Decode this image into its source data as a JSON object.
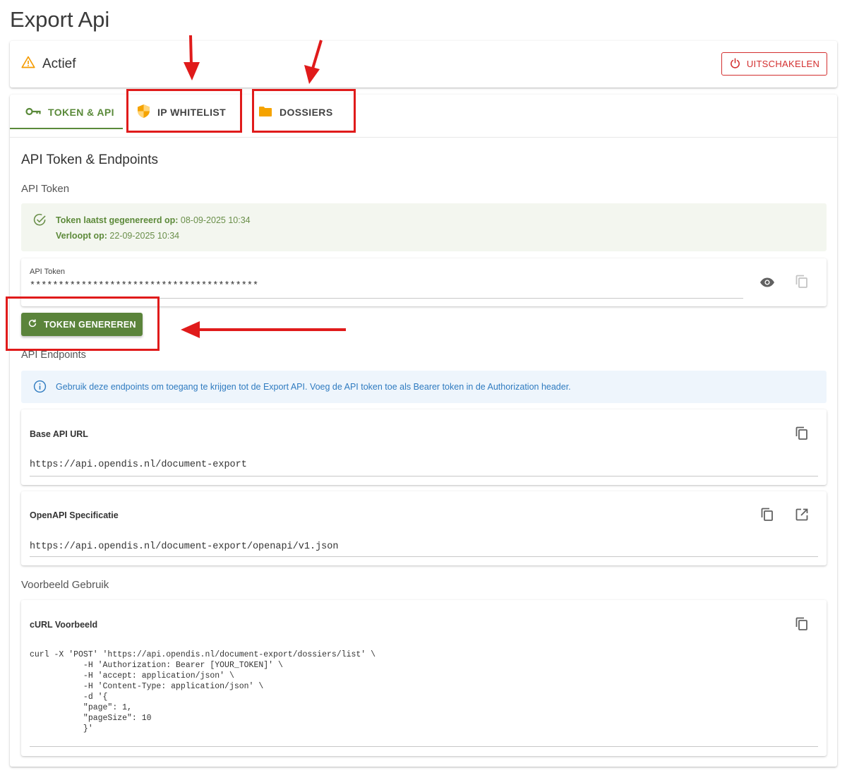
{
  "page": {
    "title": "Export Api"
  },
  "status": {
    "label": "Actief",
    "disable_button": "UITSCHAKELEN"
  },
  "tabs": [
    {
      "label": "TOKEN & API",
      "icon": "key-icon",
      "active": true
    },
    {
      "label": "IP WHITELIST",
      "icon": "shield-icon",
      "active": false
    },
    {
      "label": "DOSSIERS",
      "icon": "folder-icon",
      "active": false
    }
  ],
  "section": {
    "title": "API Token & Endpoints",
    "token_heading": "API Token",
    "generated_label": "Token laatst gegenereerd op:",
    "generated_value": "08-09-2025 10:34",
    "expires_label": "Verloopt op:",
    "expires_value": "22-09-2025 10:34",
    "token_field_label": "API Token",
    "token_field_value": "****************************************",
    "generate_button": "TOKEN GENEREREN",
    "endpoints_heading": "API Endpoints",
    "info_text": "Gebruik deze endpoints om toegang te krijgen tot de Export API. Voeg de API token toe als Bearer token in de Authorization header.",
    "base_url_label": "Base API URL",
    "base_url_value": "https://api.opendis.nl/document-export",
    "openapi_label": "OpenAPI Specificatie",
    "openapi_value": "https://api.opendis.nl/document-export/openapi/v1.json",
    "example_heading": "Voorbeeld Gebruik",
    "curl_label": "cURL Voorbeeld",
    "curl_code": "curl -X 'POST' 'https://api.opendis.nl/document-export/dossiers/list' \\\n           -H 'Authorization: Bearer [YOUR_TOKEN]' \\\n           -H 'accept: application/json' \\\n           -H 'Content-Type: application/json' \\\n           -d '{\n           \"page\": 1,\n           \"pageSize\": 10\n           }'"
  },
  "colors": {
    "accent_green": "#5b843b",
    "danger_red": "#d32f2f",
    "warning_orange": "#f59b00",
    "info_blue": "#2f7bc0",
    "annotation_red": "#e01b1b"
  }
}
